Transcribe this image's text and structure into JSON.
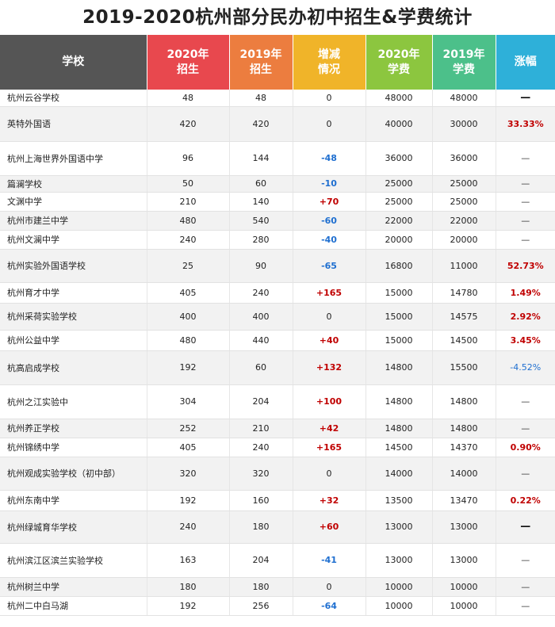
{
  "title": "2019-2020杭州部分民办初中招生&学费统计",
  "colors": {
    "school_header": "#555555",
    "enroll_2020_header": "#e8484e",
    "enroll_2019_header": "#ec7d3f",
    "change_header": "#f0b429",
    "fee_2020_header": "#8cc63f",
    "fee_2019_header": "#4cc08a",
    "rise_header": "#2eb0d9"
  },
  "headers": {
    "school": "学校",
    "enroll_2020": [
      "2020年",
      "招生"
    ],
    "enroll_2019": [
      "2019年",
      "招生"
    ],
    "change": [
      "增减",
      "情况"
    ],
    "fee_2020": [
      "2020年",
      "学费"
    ],
    "fee_2019": [
      "2019年",
      "学费"
    ],
    "rise": "涨幅"
  },
  "rows": [
    {
      "school": "杭州云谷学校",
      "e2020": "48",
      "e2019": "48",
      "change": "0",
      "f2020": "48000",
      "f2019": "48000",
      "rise": "—"
    },
    {
      "school": "英特外国语",
      "e2020": "420",
      "e2019": "420",
      "change": "0",
      "f2020": "40000",
      "f2019": "30000",
      "rise": "33.33%"
    },
    {
      "school": "杭州上海世界外国语中学",
      "e2020": "96",
      "e2019": "144",
      "change": "-48",
      "f2020": "36000",
      "f2019": "36000",
      "rise": "—"
    },
    {
      "school": "篇澜学校",
      "e2020": "50",
      "e2019": "60",
      "change": "-10",
      "f2020": "25000",
      "f2019": "25000",
      "rise": "—"
    },
    {
      "school": "文渊中学",
      "e2020": "210",
      "e2019": "140",
      "change": "+70",
      "f2020": "25000",
      "f2019": "25000",
      "rise": "—"
    },
    {
      "school": "杭州市建兰中学",
      "e2020": "480",
      "e2019": "540",
      "change": "-60",
      "f2020": "22000",
      "f2019": "22000",
      "rise": "—"
    },
    {
      "school": "杭州文澜中学",
      "e2020": "240",
      "e2019": "280",
      "change": "-40",
      "f2020": "20000",
      "f2019": "20000",
      "rise": "—"
    },
    {
      "school": "杭州实验外国语学校",
      "e2020": "25",
      "e2019": "90",
      "change": "-65",
      "f2020": "16800",
      "f2019": "11000",
      "rise": "52.73%"
    },
    {
      "school": "杭州育才中学",
      "e2020": "405",
      "e2019": "240",
      "change": "+165",
      "f2020": "15000",
      "f2019": "14780",
      "rise": "1.49%"
    },
    {
      "school": "杭州采荷实验学校",
      "e2020": "400",
      "e2019": "400",
      "change": "0",
      "f2020": "15000",
      "f2019": "14575",
      "rise": "2.92%"
    },
    {
      "school": "杭州公益中学",
      "e2020": "480",
      "e2019": "440",
      "change": "+40",
      "f2020": "15000",
      "f2019": "14500",
      "rise": "3.45%"
    },
    {
      "school": "杭高启成学校",
      "e2020": "192",
      "e2019": "60",
      "change": "+132",
      "f2020": "14800",
      "f2019": "15500",
      "rise": "-4.52%"
    },
    {
      "school": "杭州之江实验中",
      "e2020": "304",
      "e2019": "204",
      "change": "+100",
      "f2020": "14800",
      "f2019": "14800",
      "rise": "—"
    },
    {
      "school": "杭州养正学校",
      "e2020": "252",
      "e2019": "210",
      "change": "+42",
      "f2020": "14800",
      "f2019": "14800",
      "rise": "—"
    },
    {
      "school": "杭州锦绣中学",
      "e2020": "405",
      "e2019": "240",
      "change": "+165",
      "f2020": "14500",
      "f2019": "14370",
      "rise": "0.90%"
    },
    {
      "school": "杭州观成实验学校（初中部）",
      "e2020": "320",
      "e2019": "320",
      "change": "0",
      "f2020": "14000",
      "f2019": "14000",
      "rise": "—"
    },
    {
      "school": "杭州东南中学",
      "e2020": "192",
      "e2019": "160",
      "change": "+32",
      "f2020": "13500",
      "f2019": "13470",
      "rise": "0.22%"
    },
    {
      "school": "杭州绿城育华学校",
      "e2020": "240",
      "e2019": "180",
      "change": "+60",
      "f2020": "13000",
      "f2019": "13000",
      "rise": "—"
    },
    {
      "school": "杭州滨江区滨兰实验学校",
      "e2020": "163",
      "e2019": "204",
      "change": "-41",
      "f2020": "13000",
      "f2019": "13000",
      "rise": "—"
    },
    {
      "school": "杭州树兰中学",
      "e2020": "180",
      "e2019": "180",
      "change": "0",
      "f2020": "10000",
      "f2019": "10000",
      "rise": "—"
    },
    {
      "school": "杭州二中白马湖",
      "e2020": "192",
      "e2019": "256",
      "change": "-64",
      "f2020": "10000",
      "f2019": "10000",
      "rise": "—"
    }
  ]
}
